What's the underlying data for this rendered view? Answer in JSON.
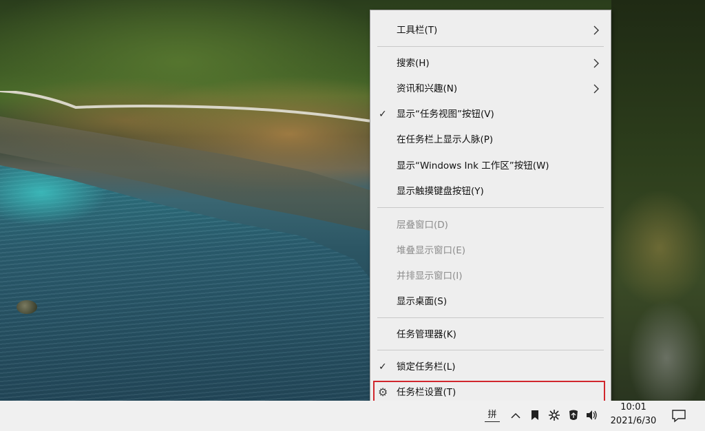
{
  "context_menu": {
    "items": [
      {
        "label": "工具栏(T)",
        "submenu": true,
        "checked": false,
        "enabled": true
      },
      {
        "label": "搜索(H)",
        "submenu": true,
        "checked": false,
        "enabled": true
      },
      {
        "label": "资讯和兴趣(N)",
        "submenu": true,
        "checked": false,
        "enabled": true
      },
      {
        "label": "显示“任务视图”按钮(V)",
        "submenu": false,
        "checked": true,
        "enabled": true
      },
      {
        "label": "在任务栏上显示人脉(P)",
        "submenu": false,
        "checked": false,
        "enabled": true
      },
      {
        "label": "显示“Windows Ink 工作区”按钮(W)",
        "submenu": false,
        "checked": false,
        "enabled": true
      },
      {
        "label": "显示触摸键盘按钮(Y)",
        "submenu": false,
        "checked": false,
        "enabled": true
      },
      {
        "label": "层叠窗口(D)",
        "submenu": false,
        "checked": false,
        "enabled": false
      },
      {
        "label": "堆叠显示窗口(E)",
        "submenu": false,
        "checked": false,
        "enabled": false
      },
      {
        "label": "并排显示窗口(I)",
        "submenu": false,
        "checked": false,
        "enabled": false
      },
      {
        "label": "显示桌面(S)",
        "submenu": false,
        "checked": false,
        "enabled": true
      },
      {
        "label": "任务管理器(K)",
        "submenu": false,
        "checked": false,
        "enabled": true
      },
      {
        "label": "锁定任务栏(L)",
        "submenu": false,
        "checked": true,
        "enabled": true
      },
      {
        "label": "任务栏设置(T)",
        "submenu": false,
        "checked": false,
        "enabled": true,
        "icon": "gear-icon",
        "highlighted": true
      }
    ],
    "check_glyph": "✓",
    "highlight_color": "#d1262c"
  },
  "taskbar": {
    "ime_label": "拼",
    "tray_icons": [
      "chevron-up-icon",
      "bookmark-icon",
      "sync-icon",
      "security-icon",
      "volume-icon"
    ],
    "time": "10:01",
    "date": "2021/6/30",
    "notification_icon": "notification-icon"
  }
}
